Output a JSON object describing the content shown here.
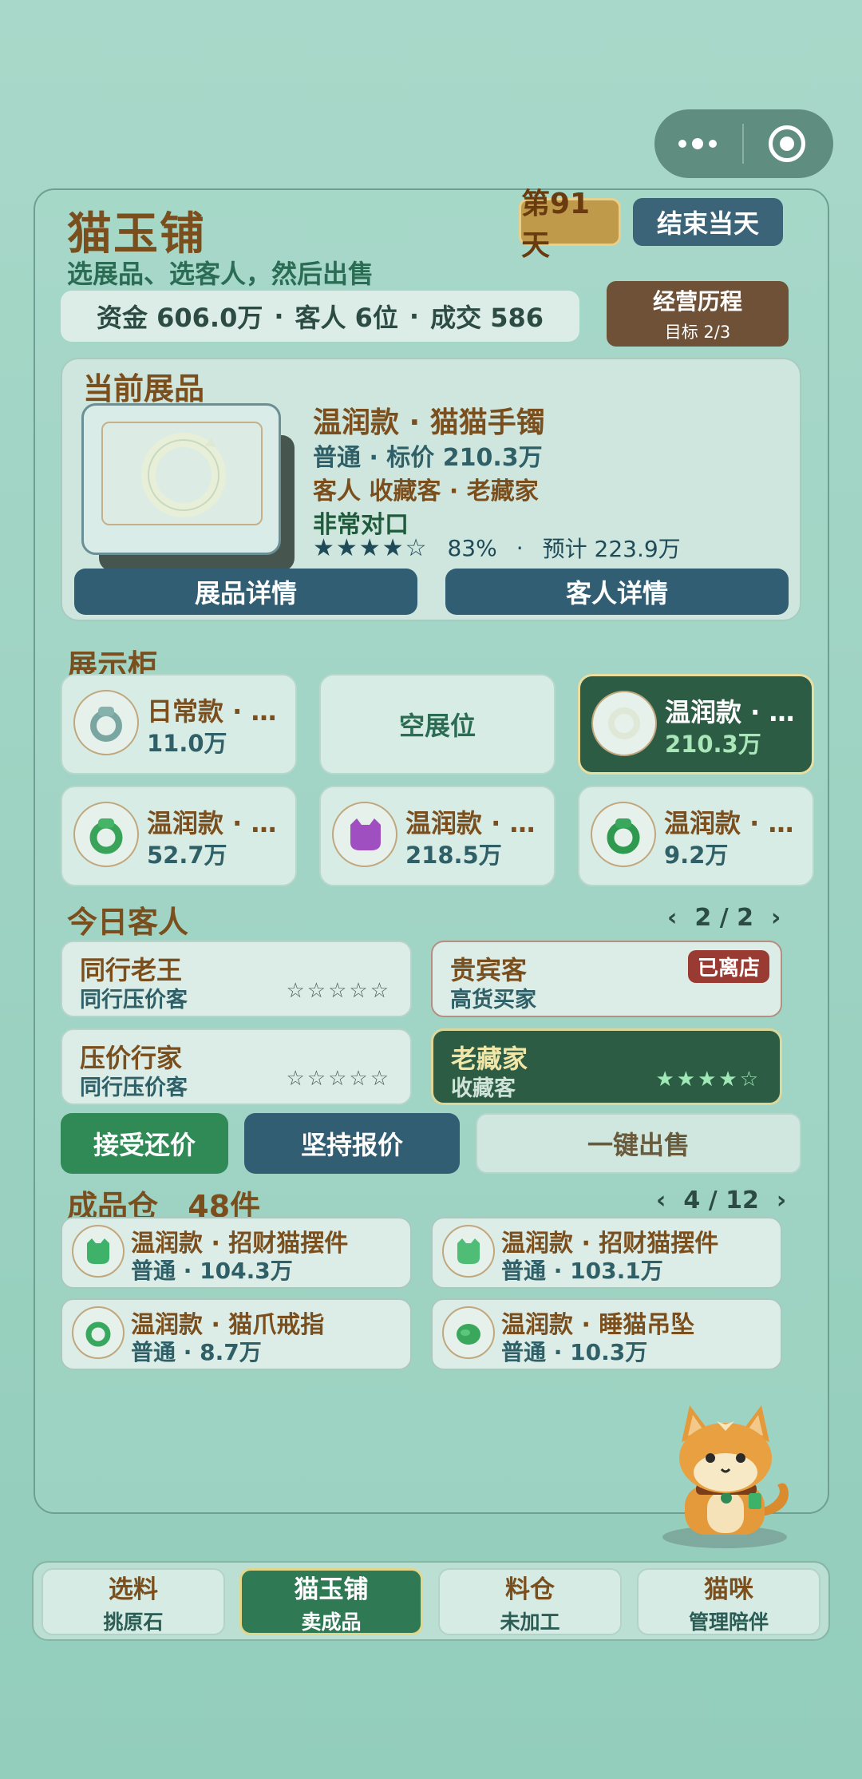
{
  "header": {
    "title": "猫玉铺",
    "subtitle": "选展品、选客人，然后出售",
    "day_label": "第91天",
    "end_day_label": "结束当天"
  },
  "stats": {
    "funds": "资金 606.0万",
    "customers": "客人 6位",
    "deals": "成交 586",
    "separator": "·"
  },
  "history": {
    "label": "经营历程",
    "target": "目标 2/3"
  },
  "exhibit": {
    "section_title": "当前展品",
    "name": "温润款 · 猫猫手镯",
    "grade_price": "普通 · 标价 210.3万",
    "customer_line": "客人 收藏客 · 老藏家",
    "match": "非常对口",
    "stars": "★★★★☆",
    "percent": "83%",
    "separator": "·",
    "estimate": "预计 223.9万",
    "detail_button": "展品详情",
    "customer_button": "客人详情"
  },
  "showcase": {
    "section_title": "展示柜",
    "slots": [
      {
        "name": "日常款 · 猫...",
        "price": "11.0万",
        "icon": "ring-icon"
      },
      {
        "empty_label": "空展位"
      },
      {
        "name": "温润款 · 猫...",
        "price": "210.3万",
        "icon": "bangle-icon",
        "selected": true
      },
      {
        "name": "温润款 · 猫...",
        "price": "52.7万",
        "icon": "ring-icon"
      },
      {
        "name": "温润款 · 招...",
        "price": "218.5万",
        "icon": "cat-figure-icon"
      },
      {
        "name": "温润款 · 猫...",
        "price": "9.2万",
        "icon": "ring-icon"
      }
    ]
  },
  "customers": {
    "section_title": "今日客人",
    "page": "2 / 2",
    "prev": "‹",
    "next": "›",
    "list": [
      {
        "name": "同行老王",
        "type": "同行压价客",
        "stars": "☆☆☆☆☆"
      },
      {
        "name": "贵宾客",
        "type": "高货买家",
        "badge": "已离店"
      },
      {
        "name": "压价行家",
        "type": "同行压价客",
        "stars": "☆☆☆☆☆"
      },
      {
        "name": "老藏家",
        "type": "收藏客",
        "stars": "★★★★☆",
        "selected": true
      }
    ]
  },
  "actions": {
    "accept": "接受还价",
    "insist": "坚持报价",
    "quick_sell": "一键出售"
  },
  "inventory": {
    "section_title": "成品仓",
    "count": "48件",
    "page": "4 / 12",
    "prev": "‹",
    "next": "›",
    "items": [
      {
        "name": "温润款 · 招财猫摆件",
        "detail": "普通 · 104.3万"
      },
      {
        "name": "温润款 · 招财猫摆件",
        "detail": "普通 · 103.1万"
      },
      {
        "name": "温润款 · 猫爪戒指",
        "detail": "普通 · 8.7万"
      },
      {
        "name": "温润款 · 睡猫吊坠",
        "detail": "普通 · 10.3万"
      }
    ]
  },
  "tabs": [
    {
      "title": "选料",
      "subtitle": "挑原石"
    },
    {
      "title": "猫玉铺",
      "subtitle": "卖成品",
      "active": true
    },
    {
      "title": "料仓",
      "subtitle": "未加工"
    },
    {
      "title": "猫咪",
      "subtitle": "管理陪伴"
    }
  ],
  "colors": {
    "accent_green": "#2f7a54",
    "accent_blue": "#315e72",
    "title_brown": "#7a4f1d",
    "badge_red": "#9a3b33"
  }
}
